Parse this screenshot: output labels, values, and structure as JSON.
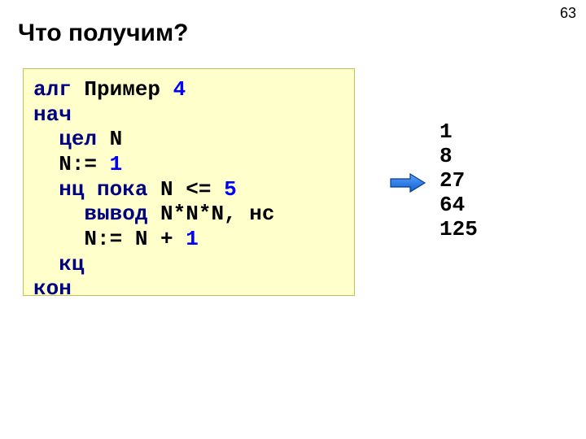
{
  "page_number": "63",
  "title": "Что получим?",
  "code": {
    "l1a": "алг",
    "l1b": " Пример ",
    "l1c": "4",
    "l2a": "нач",
    "l3a": "цел",
    "l3b": " N",
    "l4a": "N:=",
    "l4b": "1",
    "l5a": "нц пока",
    "l5b": " N <=",
    "l5c": "5",
    "l6a": "вывод",
    "l6b": " N*N*N, нс",
    "l7a": "N:=",
    "l7b": "N +",
    "l7c": "1",
    "l8a": "кц",
    "l9a": "кон"
  },
  "output": {
    "r1": "1",
    "r2": "8",
    "r3": "27",
    "r4": "64",
    "r5": "125"
  }
}
